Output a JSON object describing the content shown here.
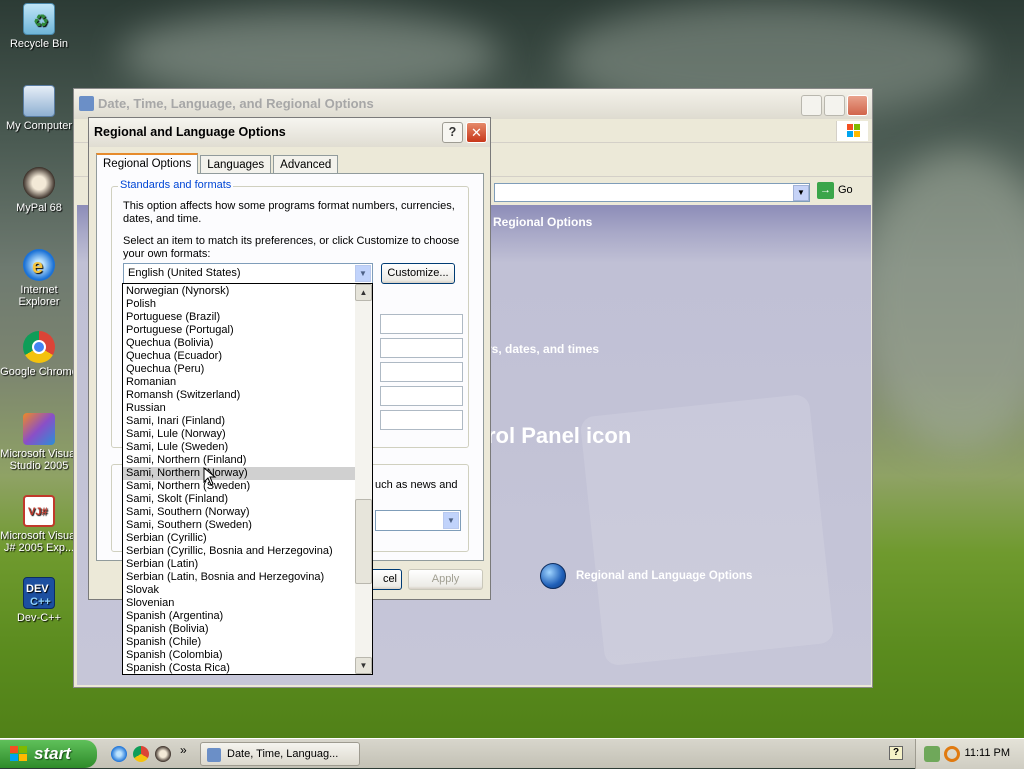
{
  "desktop": {
    "icons": [
      {
        "label": "Recycle Bin"
      },
      {
        "label": "My Computer"
      },
      {
        "label": "MyPal 68"
      },
      {
        "label": "Internet Explorer"
      },
      {
        "label": "Google Chrome"
      },
      {
        "label": "Microsoft Visual Studio 2005"
      },
      {
        "label": "Microsoft Visual J# 2005 Exp..."
      },
      {
        "label": "Dev-C++"
      }
    ]
  },
  "control_panel": {
    "title": "Date, Time, Language, and Regional Options",
    "go_label": "Go",
    "sidebar_heading_fragment": "Regional Options",
    "pick_task_fragment": "rs, dates, and times",
    "pick_icon_fragment": "rol Panel icon",
    "regional_link": "Regional and Language Options"
  },
  "dialog": {
    "title": "Regional and Language Options",
    "help_glyph": "?",
    "close_glyph": "✕",
    "tabs": [
      "Regional Options",
      "Languages",
      "Advanced"
    ],
    "group_label": "Standards and formats",
    "description": "This option affects how some programs format numbers, currencies, dates, and time.",
    "instruction": "Select an item to match its preferences, or click Customize to choose your own formats:",
    "selected_locale": "English (United States)",
    "customize_label": "Customize...",
    "location_text_fragment": "uch as news and",
    "cancel_fragment": "cel",
    "apply_label": "Apply",
    "dropdown_items": [
      "Norwegian (Nynorsk)",
      "Polish",
      "Portuguese (Brazil)",
      "Portuguese (Portugal)",
      "Quechua (Bolivia)",
      "Quechua (Ecuador)",
      "Quechua (Peru)",
      "Romanian",
      "Romansh (Switzerland)",
      "Russian",
      "Sami, Inari (Finland)",
      "Sami, Lule (Norway)",
      "Sami, Lule (Sweden)",
      "Sami, Northern (Finland)",
      "Sami, Northern (Norway)",
      "Sami, Northern (Sweden)",
      "Sami, Skolt (Finland)",
      "Sami, Southern (Norway)",
      "Sami, Southern (Sweden)",
      "Serbian (Cyrillic)",
      "Serbian (Cyrillic, Bosnia and Herzegovina)",
      "Serbian (Latin)",
      "Serbian (Latin, Bosnia and Herzegovina)",
      "Slovak",
      "Slovenian",
      "Spanish (Argentina)",
      "Spanish (Bolivia)",
      "Spanish (Chile)",
      "Spanish (Colombia)",
      "Spanish (Costa Rica)"
    ],
    "hovered_item": "Sami, Northern (Norway)"
  },
  "taskbar": {
    "start_label": "start",
    "task_label": "Date, Time, Languag...",
    "clock": "11:11 PM",
    "chevron": "»",
    "help_glyph": "?"
  }
}
